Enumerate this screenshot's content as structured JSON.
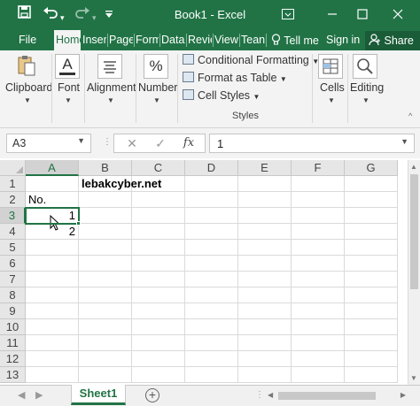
{
  "window": {
    "title": "Book1 - Excel",
    "minimize_icon": "minimize-icon",
    "maximize_icon": "maximize-icon",
    "close_icon": "close-icon",
    "ribbon_display_icon": "ribbon-display-options-icon",
    "theme_color": "#217346"
  },
  "quick_access": {
    "save_icon": "save-icon",
    "undo_icon": "undo-icon",
    "redo_icon": "redo-icon",
    "customize_icon": "customize-dropdown-icon"
  },
  "tabs": [
    "File",
    "Home",
    "Inser",
    "Page",
    "Form",
    "Data",
    "Revie",
    "View",
    "Tean"
  ],
  "tell_me": "Tell me",
  "sign_in": "Sign in",
  "share": "Share",
  "ribbon": {
    "clipboard": "Clipboard",
    "font": "Font",
    "alignment": "Alignment",
    "number": "Number",
    "conditional_formatting": "Conditional Formatting",
    "format_as_table": "Format as Table",
    "cell_styles": "Cell Styles",
    "styles_group": "Styles",
    "cells": "Cells",
    "editing": "Editing",
    "number_symbol": "%",
    "font_symbol": "A"
  },
  "formula_bar": {
    "name_box": "A3",
    "formula_value": "1",
    "cancel_symbol": "✕",
    "enter_symbol": "✓",
    "fx_symbol": "fx"
  },
  "grid": {
    "columns": [
      "A",
      "B",
      "C",
      "D",
      "E",
      "F",
      "G"
    ],
    "rows": [
      "1",
      "2",
      "3",
      "4",
      "5",
      "6",
      "7",
      "8",
      "9",
      "10",
      "11",
      "12",
      "13"
    ],
    "cells": {
      "B1": "lebakcyber.net",
      "A2": "No.",
      "A3": "1",
      "A4": "2"
    },
    "active_cell": "A3"
  },
  "sheets": {
    "tabs": [
      "Sheet1"
    ],
    "add_symbol": "+"
  }
}
